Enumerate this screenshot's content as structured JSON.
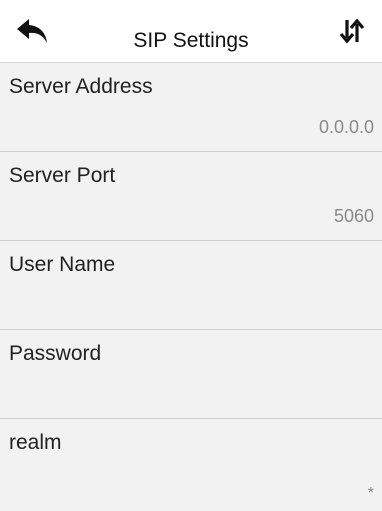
{
  "header": {
    "title": "SIP Settings",
    "back_icon": "back-arrow-icon",
    "sort_icon": "sort-arrows-icon"
  },
  "settings": [
    {
      "label": "Server Address",
      "value": "0.0.0.0"
    },
    {
      "label": "Server Port",
      "value": "5060"
    },
    {
      "label": "User Name",
      "value": ""
    },
    {
      "label": "Password",
      "value": ""
    },
    {
      "label": "realm",
      "value": "*"
    }
  ]
}
